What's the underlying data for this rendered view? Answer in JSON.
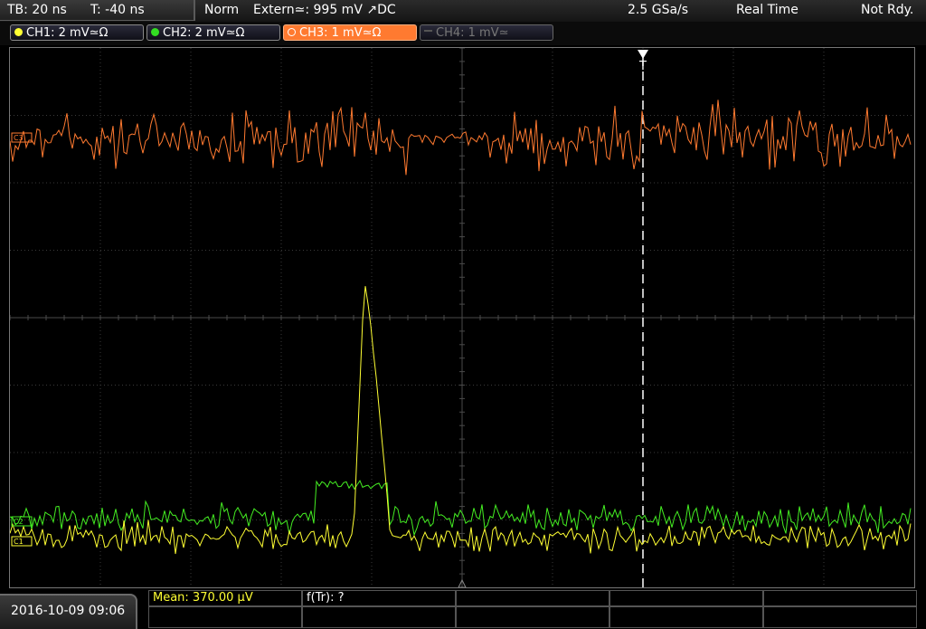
{
  "status": {
    "timebase": "TB: 20 ns",
    "trigger_time": "T: -40 ns",
    "trigger_mode": "Norm",
    "trigger_source": "Extern≃: 995 mV ↗DC",
    "sample_rate": "2.5 GSa/s",
    "acq_mode": "Real Time",
    "run_state": "Not Rdy."
  },
  "channels": [
    {
      "label": "CH1: 2 mV≃Ω",
      "color": "#ffff33",
      "active": true
    },
    {
      "label": "CH2: 2 mV≃Ω",
      "color": "#33dd22",
      "active": true
    },
    {
      "label": "CH3: 1 mV≃Ω",
      "color": "#ff7a30",
      "active": true,
      "selected": true
    },
    {
      "label": "CH4: 1 mV≃",
      "color": "#777777",
      "active": false
    }
  ],
  "plot": {
    "trigger_marker": "T",
    "ch3_marker": "C3",
    "ch1_marker": "C1",
    "ch2_marker": "C2",
    "colors": {
      "ch1": "#ffff33",
      "ch2": "#44ee22",
      "ch3": "#ff7a30",
      "grid": "#3a3a3a"
    }
  },
  "footer": {
    "datetime": "2016-10-09 09:06",
    "measurement_1": "Mean: 370.00 µV",
    "measurement_2": "f(Tr): ?"
  }
}
